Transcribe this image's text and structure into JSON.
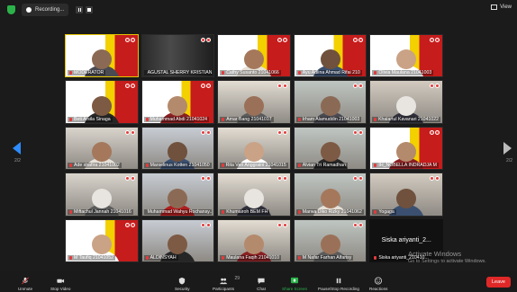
{
  "topbar": {
    "recording_label": "Recording...",
    "view_label": "View"
  },
  "pagination": {
    "left_page": "2/2",
    "right_page": "2/2"
  },
  "participants": [
    {
      "name": "MODERATOR",
      "kind": "poster",
      "active": true
    },
    {
      "name": "AGUSTAL SHERRY KRISTIAN",
      "kind": "dark"
    },
    {
      "name": "Cathy Susanto 21041066",
      "kind": "poster-person"
    },
    {
      "name": "Ayu Adlina Ahmad Rifai 210",
      "kind": "poster-person"
    },
    {
      "name": "Olivia Maulana 21041003",
      "kind": "poster-person"
    },
    {
      "name": "Beti Arsila Sinaga",
      "kind": "poster-person"
    },
    {
      "name": "Muhammad Abdi 21041024",
      "kind": "poster"
    },
    {
      "name": "Amar Bang 21041017",
      "kind": "person"
    },
    {
      "name": "Irham Alamuddin 21041003",
      "kind": "person"
    },
    {
      "name": "Khalartul Kavanari 21041022",
      "kind": "person-hijab"
    },
    {
      "name": "Ade shafira 21041002",
      "kind": "person"
    },
    {
      "name": "Marselinus Kotten 21041050",
      "kind": "person"
    },
    {
      "name": "Rita Veri Anggraini 21041015",
      "kind": "person"
    },
    {
      "name": "Alvian Tri Ramadhan",
      "kind": "person"
    },
    {
      "name": "IH_NOBELLA INDRADJA M",
      "kind": "poster-person"
    },
    {
      "name": "Miftachul Jannah 21041016",
      "kind": "person-hijab"
    },
    {
      "name": "Muhammad Wahyu Rochansy...",
      "kind": "person-red"
    },
    {
      "name": "Khumairoh BEM FH",
      "kind": "person-hijab"
    },
    {
      "name": "Marwa Diko Rizky 21041062",
      "kind": "person"
    },
    {
      "name": "Yogaga",
      "kind": "person"
    },
    {
      "name": "M Taufiq 21041052",
      "kind": "poster-person"
    },
    {
      "name": "ALDINSYAH",
      "kind": "person"
    },
    {
      "name": "Maulana Faqih 21041010",
      "kind": "person"
    },
    {
      "name": "M Nafar Farhan Alfarisy",
      "kind": "person"
    },
    {
      "name": "Siska ariyanti_2...",
      "kind": "text",
      "label": "Siska ariyanti_210410..."
    }
  ],
  "watermark": {
    "title": "Activate Windows",
    "subtitle": "Go to Settings to activate Windows."
  },
  "toolbar": {
    "unmute": "Unmute",
    "stop_video": "Stop Video",
    "security": "Security",
    "participants": "Participants",
    "participants_count": "29",
    "chat": "Chat",
    "share_screen": "Share Screen",
    "pause_recording": "Pause/Stop Recording",
    "reactions": "Reactions",
    "leave": "Leave"
  },
  "colors": {
    "share_green": "#2bb34a",
    "leave_red": "#e02828",
    "active_border": "#e4c400",
    "arrow_blue": "#2d8cff"
  }
}
